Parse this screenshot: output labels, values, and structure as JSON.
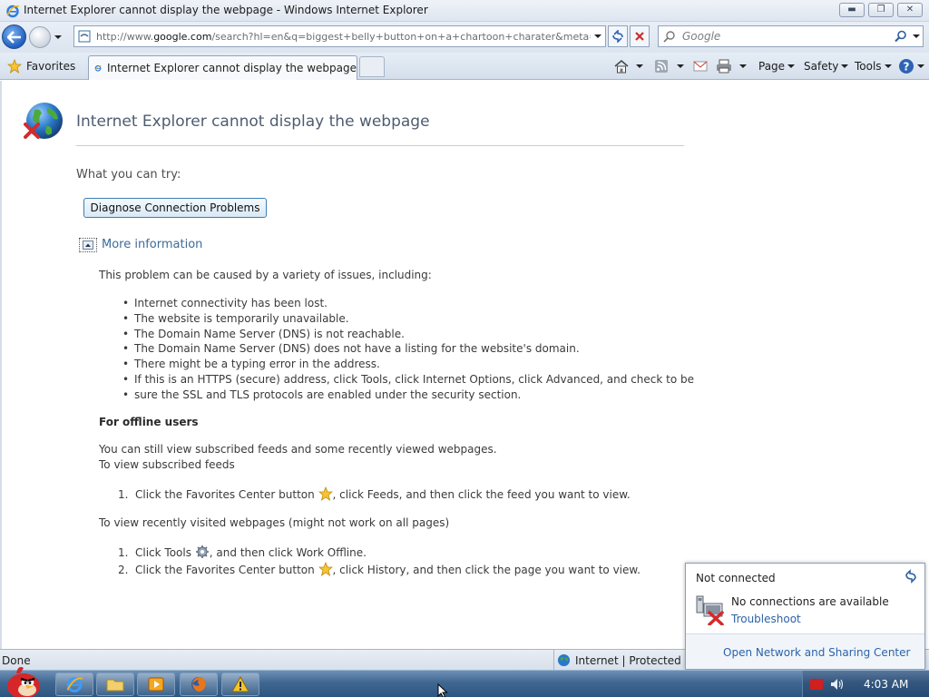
{
  "window": {
    "title": "Internet Explorer cannot display the webpage - Windows Internet Explorer",
    "min_glyph": "▬",
    "max_glyph": "❐",
    "close_glyph": "✕"
  },
  "address_bar": {
    "url_prefix": "http://www.",
    "url_domain": "google.com",
    "url_rest": "/search?hl=en&q=biggest+belly+button+on+a+chartoon+charater&meta="
  },
  "search": {
    "placeholder": "Google"
  },
  "command_bar": {
    "favorites_label": "Favorites",
    "tab_title": "Internet Explorer cannot display the webpage",
    "page_label": "Page",
    "safety_label": "Safety",
    "tools_label": "Tools"
  },
  "error_page": {
    "title": "Internet Explorer cannot display the webpage",
    "what_you_can_try": "What you can try:",
    "diagnose_button": "Diagnose Connection Problems",
    "more_info_link": "More information",
    "cause_intro": "This problem can be caused by a variety of issues, including:",
    "causes": [
      "Internet connectivity has been lost.",
      "The website is temporarily unavailable.",
      "The Domain Name Server (DNS) is not reachable.",
      "The Domain Name Server (DNS) does not have a listing for the website's domain.",
      "There might be a typing error in the address.",
      "If this is an HTTPS (secure) address, click Tools, click Internet Options, click Advanced, and check to be",
      "sure the SSL and TLS protocols are enabled under the security section."
    ],
    "offline_heading": "For offline users",
    "offline_line1": "You can still view subscribed feeds and some recently viewed webpages.",
    "offline_line2": "To view subscribed feeds",
    "feeds_steps": [
      {
        "num": "1.",
        "before": "Click the Favorites Center button ",
        "after": ", click Feeds, and then click the feed you want to view."
      }
    ],
    "recent_intro": "To view recently visited webpages (might not work on all pages)",
    "recent_steps": [
      {
        "num": "1.",
        "before": "Click Tools ",
        "after": ", and then click Work Offline."
      },
      {
        "num": "2.",
        "before": "Click the Favorites Center button ",
        "after": ", click History, and then click the page you want to view."
      }
    ]
  },
  "status_bar": {
    "status": "Done",
    "zone": "Internet | Protected Mo"
  },
  "network_flyout": {
    "status": "Not connected",
    "message": "No connections are available",
    "troubleshoot": "Troubleshoot",
    "open_center": "Open Network and Sharing Center"
  },
  "taskbar": {
    "clock": "4:03 AM"
  },
  "colors": {
    "link": "#3b6c9a",
    "flyout_link": "#2c63a8",
    "taskbar": "#3f6791",
    "error_title": "#4d5d70"
  }
}
